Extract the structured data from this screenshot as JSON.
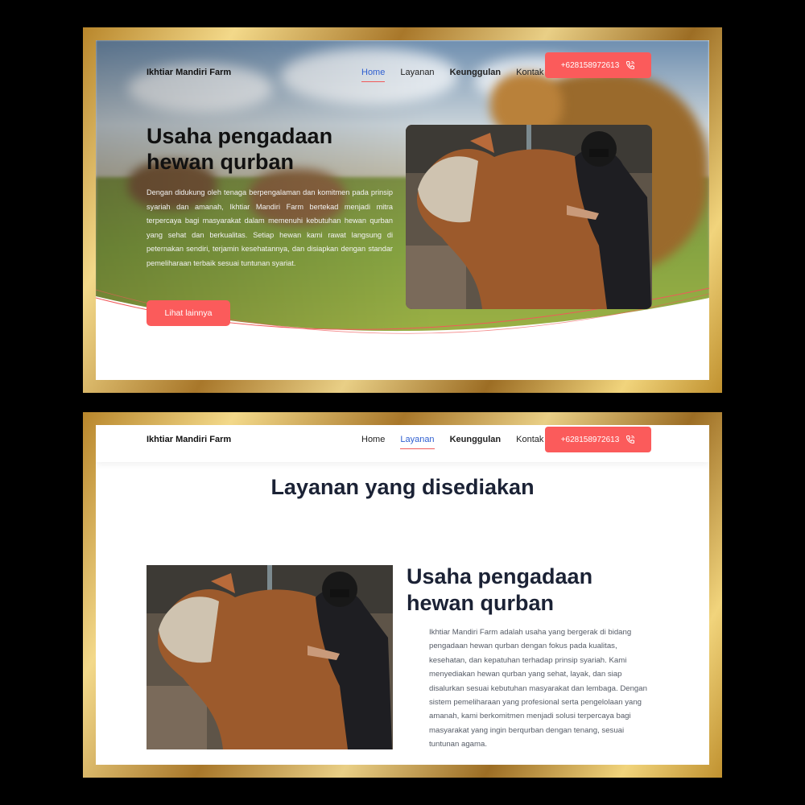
{
  "hero": {
    "brand": "Ikhtiar Mandiri Farm",
    "nav": [
      "Home",
      "Layanan",
      "Keunggulan",
      "Kontak"
    ],
    "active_nav": "Home",
    "phone": "+628158972613",
    "title": "Usaha pengadaan hewan qurban",
    "description": "Dengan didukung oleh tenaga berpengalaman dan komitmen pada prinsip syariah dan amanah, Ikhtiar Mandiri Farm bertekad menjadi mitra terpercaya bagi masyarakat dalam memenuhi kebutuhan hewan qurban yang sehat dan berkualitas. Setiap hewan kami rawat langsung di peternakan sendiri, terjamin kesehatannya, dan disiapkan dengan standar pemeliharaan terbaik sesuai tuntunan syariat.",
    "cta": "Lihat lainnya"
  },
  "services": {
    "brand": "Ikhtiar Mandiri Farm",
    "nav": [
      "Home",
      "Layanan",
      "Keunggulan",
      "Kontak"
    ],
    "active_nav": "Layanan",
    "phone": "+628158972613",
    "section_title": "Layanan yang disediakan",
    "item_title": "Usaha pengadaan hewan qurban",
    "item_description": "Ikhtiar Mandiri Farm adalah usaha yang bergerak di bidang pengadaan hewan qurban dengan fokus pada kualitas, kesehatan, dan kepatuhan terhadap prinsip syariah. Kami menyediakan hewan qurban yang sehat, layak, dan siap disalurkan sesuai kebutuhan masyarakat dan lembaga. Dengan sistem pemeliharaan yang profesional serta pengelolaan yang amanah, kami berkomitmen menjadi solusi terpercaya bagi masyarakat yang ingin berqurban dengan tenang, sesuai tuntunan agama."
  },
  "colors": {
    "accent": "#fb5b5b",
    "nav_active": "#2f5fd0",
    "heading": "#1b2235",
    "frame_gold": "#d4a843"
  },
  "icons": {
    "phone": "phone-call-icon"
  }
}
